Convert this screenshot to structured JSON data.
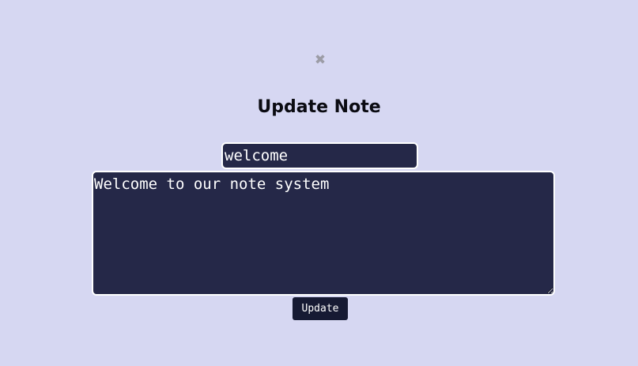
{
  "dialog": {
    "close_glyph": "✖",
    "title": "Update Note",
    "fields": {
      "note_title_value": "welcome",
      "note_body_value": "Welcome to our note system"
    },
    "update_label": "Update"
  },
  "colors": {
    "background": "#d6d7f2",
    "field_background": "#252848",
    "button_background": "#161a33",
    "close_icon": "#9c9ca6"
  }
}
